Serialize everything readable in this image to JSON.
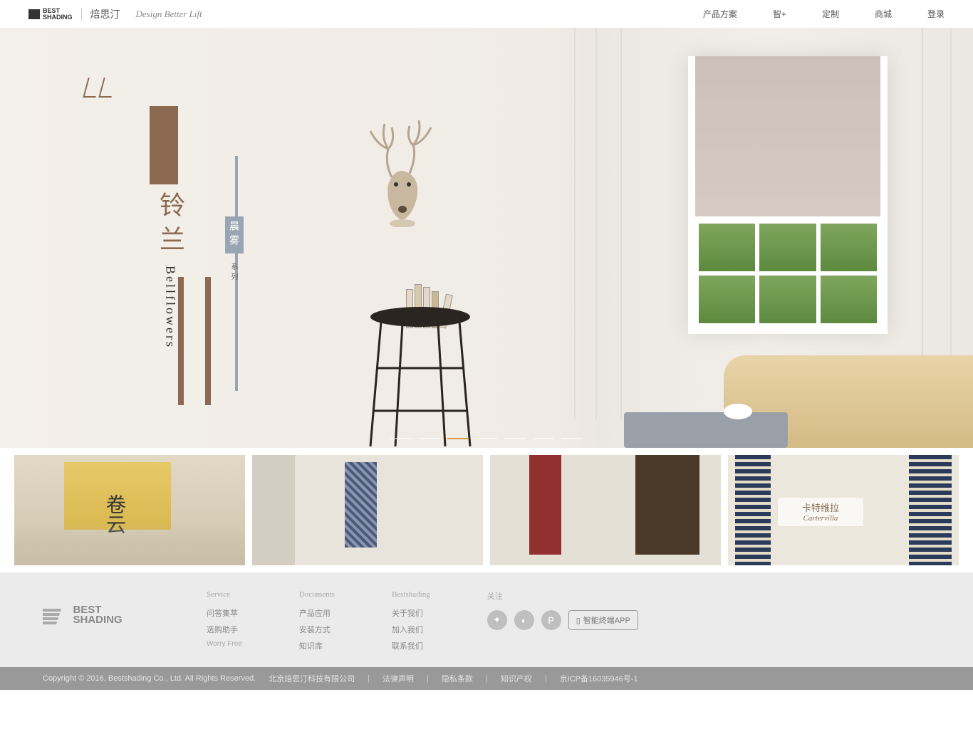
{
  "header": {
    "logo_text": "BEST\nSHADING",
    "brand_cn": "焙思汀",
    "tagline": "Design Better Lift",
    "nav": [
      "产品方案",
      "智+",
      "定制",
      "商城",
      "登录"
    ]
  },
  "hero": {
    "title_cn": "铃兰",
    "title_en": "Bellflowers",
    "subtitle": "晨雾",
    "subtitle_suffix": "系列"
  },
  "thumbs": {
    "t1": "卷云",
    "t4_cn": "卡特维拉",
    "t4_en": "Cartervilla"
  },
  "footer": {
    "cols": [
      {
        "title": "Service",
        "links": [
          "问答集萃",
          "选购助手"
        ],
        "sub": "Worry Free"
      },
      {
        "title": "Documents",
        "links": [
          "产品应用",
          "安装方式",
          "知识库"
        ]
      },
      {
        "title": "Bestshading",
        "links": [
          "关于我们",
          "加入我们",
          "联系我们"
        ]
      }
    ],
    "follow_title": "关注",
    "app_btn": "智能终端APP",
    "logo_text": "BEST\nSHADING"
  },
  "bottom": {
    "copyright": "Copyright © 2016, Bestshading Co., Ltd. All Rights Reserved.",
    "company": "北京焙思汀科技有限公司",
    "links": [
      "法律声明",
      "隐私条款",
      "知识产权"
    ],
    "icp": "京ICP备16035946号-1"
  }
}
